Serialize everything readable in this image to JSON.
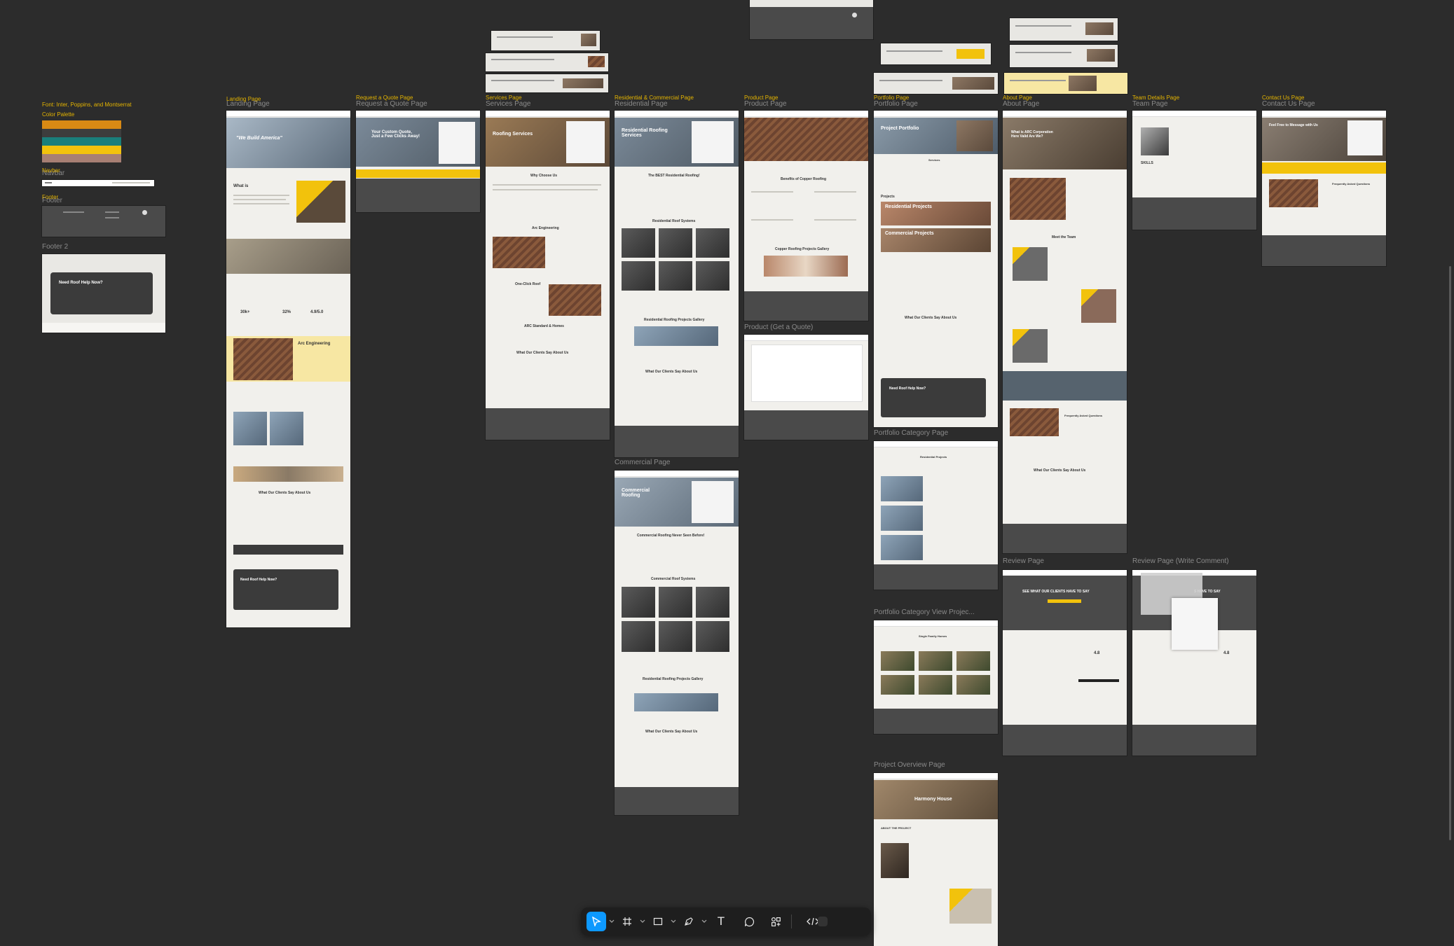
{
  "style_notes": {
    "fonts_text": "Font: Inter, Poppins, and Montserrat",
    "palette_label": "Color Palette",
    "palette_colors": [
      "#d98a14",
      "#3d3d3d",
      "#1a7f7b",
      "#f2c20c",
      "#a77f73"
    ]
  },
  "components": {
    "navbar_label": "Navbar",
    "navbar_label_shadow": "Navbar",
    "footer_label": "Footer",
    "footer_label_shadow": "Footer",
    "footer2_label": "Footer 2",
    "need_help": "Need Roof Help Now?"
  },
  "frames": {
    "landing": {
      "yellow": "Landing Page",
      "gray": "Landing Page",
      "hero": "\"We Build America\"",
      "what_is": "What is",
      "arc_eng": "Arc Engineering",
      "stats": [
        "30k+",
        "32%",
        "4.9/5.0"
      ],
      "clients": "What Our Clients Say About Us",
      "need_help": "Need Roof Help Now?"
    },
    "quote": {
      "yellow": "Request a Quote Page",
      "gray": "Request a Quote Page",
      "hero": "Your Custom Quote, Just a Few Clicks Away!"
    },
    "services": {
      "yellow": "Services Page",
      "gray": "Services Page",
      "hero": "Roofing Services",
      "why": "Why Choose Us",
      "arc": "Arc Engineering",
      "one_click": "One-Click Roof",
      "standard": "ARC Standard & Homes",
      "clients": "What Our Clients Say About Us"
    },
    "residential": {
      "yellow": "Residential & Commercial Page",
      "gray": "Residential Page",
      "hero": "Residential Roofing Services",
      "best": "The BEST Residential Roofing!",
      "systems": "Residential Roof Systems",
      "gallery": "Residential Roofing Projects Gallery",
      "clients": "What Our Clients Say About Us"
    },
    "commercial": {
      "gray": "Commercial Page",
      "hero": "Commercial Roofing",
      "never": "Commercial Roofing Never Seen Before!",
      "systems": "Commercial Roof Systems",
      "gallery": "Residential Roofing Projects Gallery",
      "clients": "What Our Clients Say About Us"
    },
    "product": {
      "yellow": "Product Page",
      "gray": "Product Page",
      "benefits": "Benefits of Copper Roofing",
      "gallery": "Copper Roofing Projects Gallery",
      "get_quote": "Product (Get a Quote)"
    },
    "portfolio": {
      "yellow": "Portfolio Page",
      "gray": "Portfolio Page",
      "hero": "Project Portfolio",
      "services": "Services",
      "projects": "Projects",
      "residential": "Residential Projects",
      "commercial": "Commercial Projects",
      "clients": "What Our Clients Say About Us",
      "need_help": "Need Roof Help Now?"
    },
    "portfolio_category": {
      "gray": "Portfolio Category Page",
      "heading": "Residential Projects"
    },
    "portfolio_view": {
      "gray": "Portfolio Category View Projec...",
      "heading": "Single Family Homes"
    },
    "project_overview": {
      "gray": "Project Overview Page",
      "hero": "Harmony House",
      "about": "ABOUT THE PROJECT"
    },
    "about": {
      "yellow": "About Page",
      "gray": "About Page",
      "hero": "What is ARC Corporation Here Valid Are We?",
      "team": "Meet the Team",
      "faq": "Frequently Asked Questions",
      "clients": "What Our Clients Say About Us"
    },
    "review": {
      "gray": "Review Page",
      "heading": "SEE WHAT OUR CLIENTS HAVE TO SAY",
      "rating": "4.8"
    },
    "review_write": {
      "gray": "Review Page (Write Comment)",
      "heading": "S HAVE TO SAY",
      "rating": "4.8"
    },
    "team": {
      "yellow": "Team Details Page",
      "gray": "Team Page",
      "skills": "SKILLS"
    },
    "contact": {
      "yellow": "Contact Us Page",
      "gray": "Contact Us Page",
      "hero": "Feel Free to Message with Us",
      "faq": "Frequently Asked Questions"
    }
  },
  "toolbar": {
    "tools": [
      "move-tool",
      "frame-tool",
      "shape-tool",
      "pen-tool",
      "text-tool",
      "comment-tool",
      "components-tool",
      "dev-mode-tool"
    ],
    "active": "move-tool",
    "text_glyph": "T"
  }
}
